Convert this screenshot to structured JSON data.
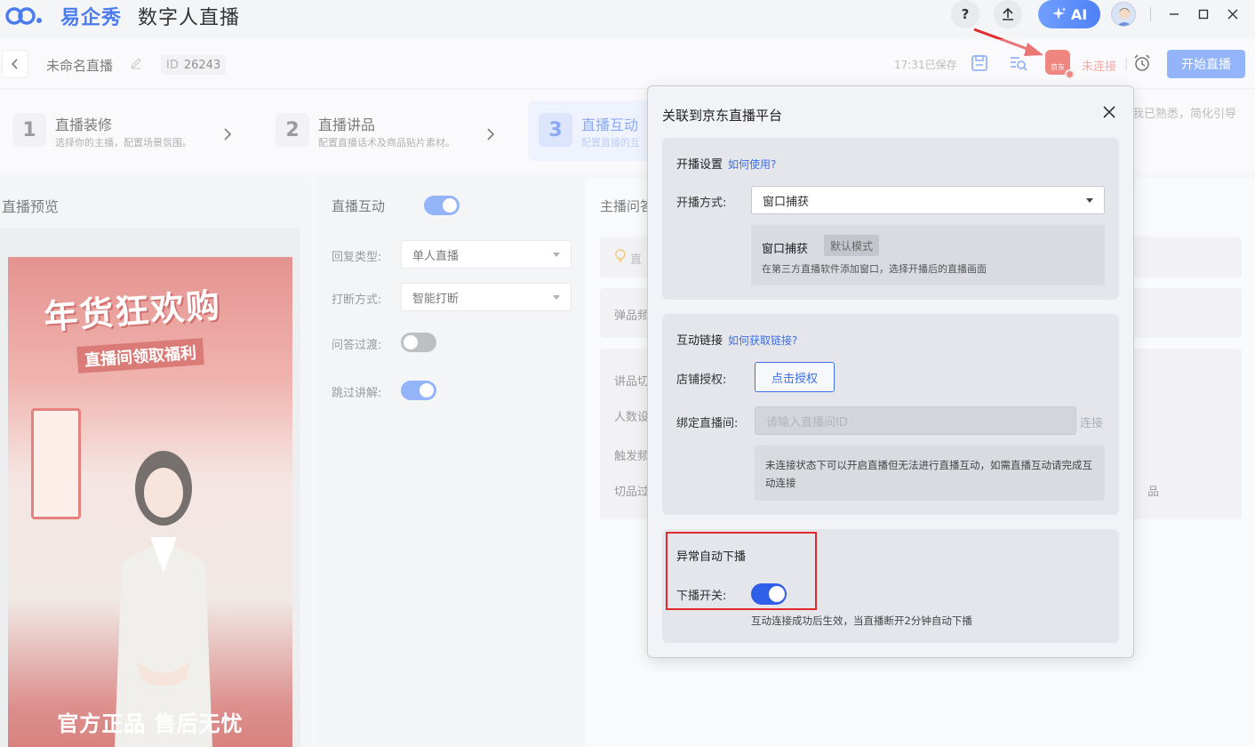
{
  "app": {
    "brand": "易企秀",
    "product": "数字人直播",
    "ai_label": "AI",
    "help_label": "?"
  },
  "header": {
    "live_name": "未命名直播",
    "id_label": "ID",
    "id_value": "26243",
    "saved_text": "17:31已保存",
    "connection_status": "未连接",
    "status_separator": "|",
    "jd_badge": "京东",
    "start_button": "开始直播"
  },
  "steps": [
    {
      "num": "1",
      "title": "直播装修",
      "desc": "选择你的主播，配置场景氛围。"
    },
    {
      "num": "2",
      "title": "直播讲品",
      "desc": "配置直播话术及商品贴片素材。"
    },
    {
      "num": "3",
      "title": "直播互动",
      "desc": "配置直播的互"
    }
  ],
  "skip_guide": "我已熟悉，简化引导",
  "preview": {
    "title": "直播预览",
    "poster_title": "年货狂欢购",
    "poster_subtitle": "直播间领取福利",
    "poster_footer": "官方正品 售后无忧"
  },
  "interaction": {
    "title": "直播互动",
    "enabled": true,
    "reply_type_label": "回复类型:",
    "reply_type_value": "单人直播",
    "interrupt_label": "打断方式:",
    "interrupt_value": "智能打断",
    "transition_label": "问答过渡:",
    "transition_on": false,
    "skip_label": "跳过讲解:",
    "skip_on": true
  },
  "qa": {
    "title": "主播问答",
    "tip_prefix": "直",
    "popup_label": "弹品频",
    "switch_label": "讲品切",
    "count_label": "人数设",
    "trigger_label": "触发频",
    "cut_label": "切品过",
    "goods_suffix": "品"
  },
  "dialog": {
    "title": "关联到京东直播平台",
    "start_section": {
      "heading": "开播设置",
      "help_link": "如何使用?",
      "mode_label": "开播方式:",
      "mode_value": "窗口捕获",
      "info_mode_name": "窗口捕获",
      "info_tag": "默认模式",
      "info_desc": "在第三方直播软件添加窗口，选择开播后的直播画面"
    },
    "link_section": {
      "heading": "互动链接",
      "help_link": "如何获取链接?",
      "auth_label": "店铺授权:",
      "auth_button": "点击授权",
      "room_label": "绑定直播间:",
      "room_placeholder": "请输入直播间ID",
      "connect_label": "连接",
      "warning": "未连接状态下可以开启直播但无法进行直播互动，如需直播互动请完成互动连接"
    },
    "auto_section": {
      "heading": "异常自动下播",
      "switch_label": "下播开关:",
      "switch_on": true,
      "note": "互动连接成功后生效，当直播断开2分钟自动下播"
    }
  },
  "colors": {
    "accent": "#5b8cf6",
    "link": "#3d6fe6",
    "alert": "#f07a74",
    "highlight": "#e12b2b"
  }
}
